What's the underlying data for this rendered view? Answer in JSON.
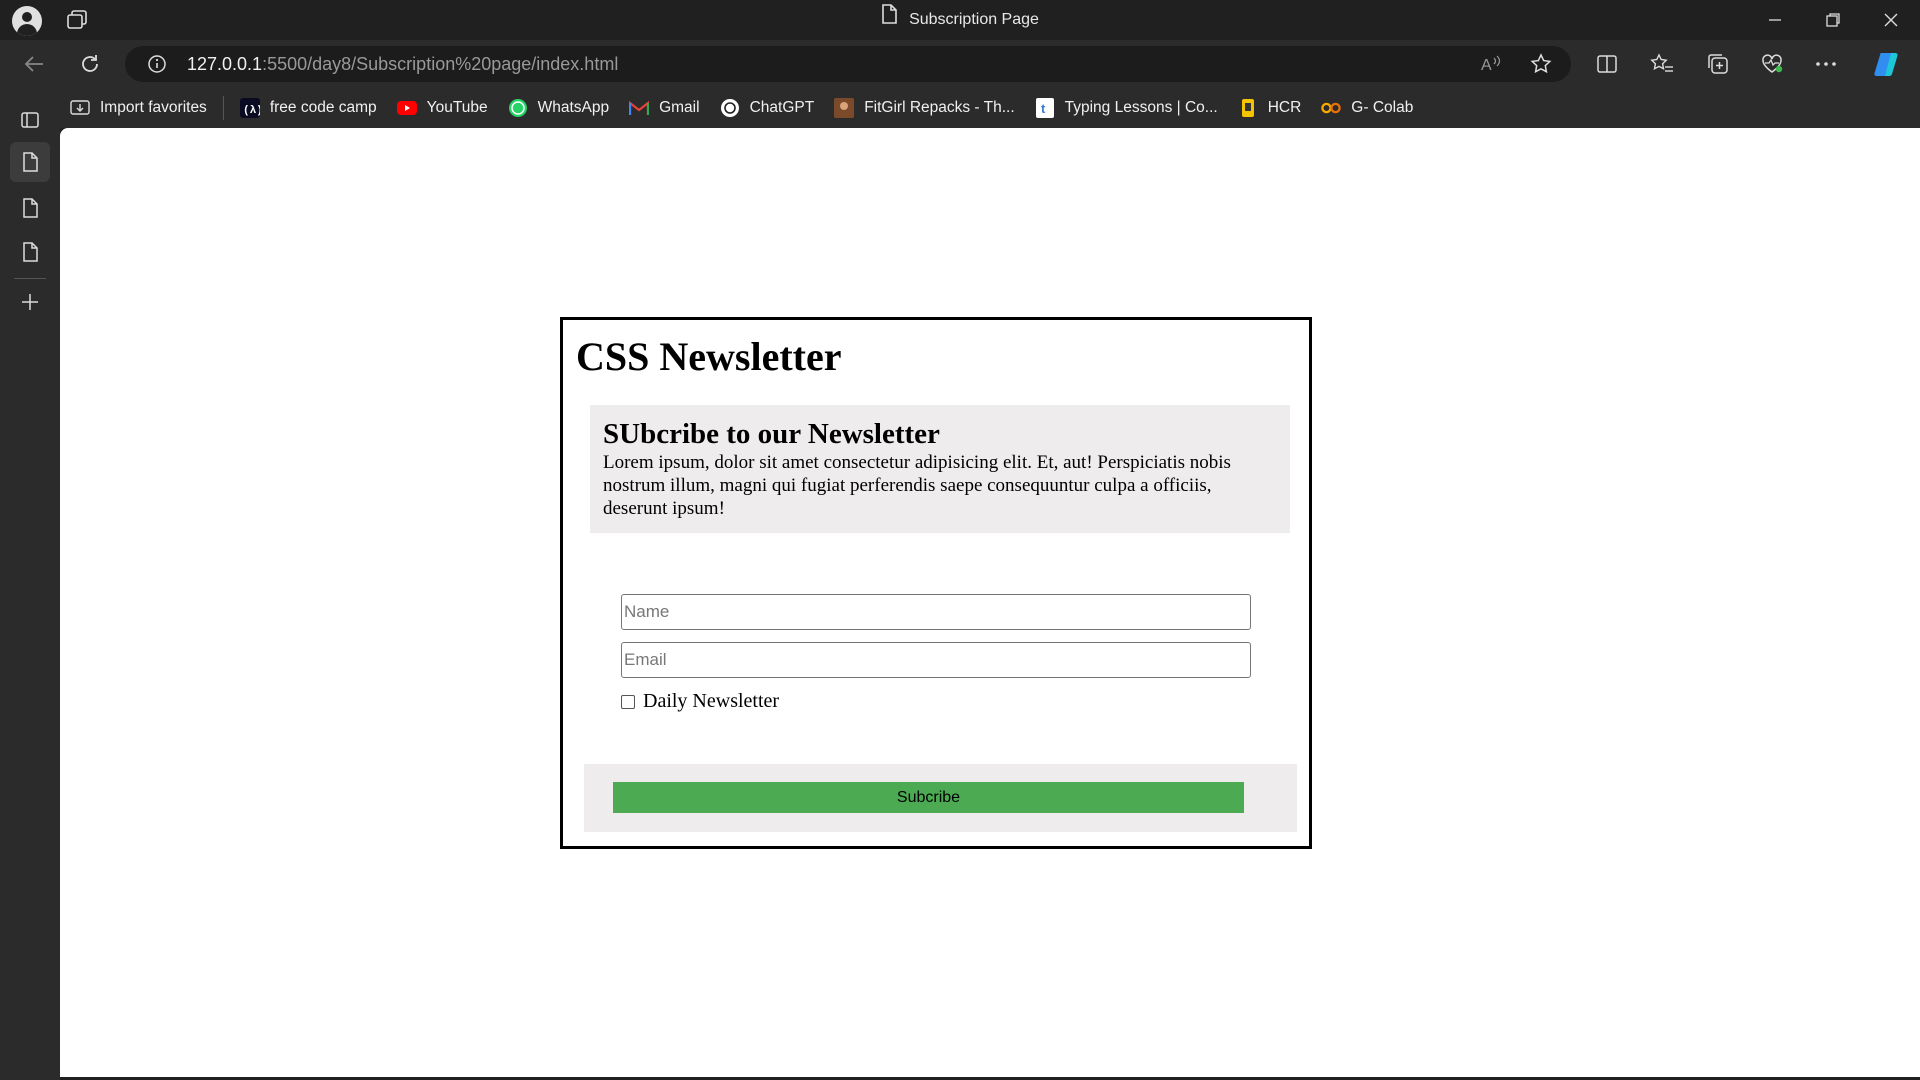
{
  "window": {
    "title": "Subscription Page",
    "url_host": "127.0.0.1",
    "url_path": ":5500/day8/Subscription%20page/index.html"
  },
  "bookmarks": [
    {
      "label": "Import favorites",
      "icon": "import-icon"
    },
    {
      "label": "free code camp",
      "icon": "freecodecamp-icon"
    },
    {
      "label": "YouTube",
      "icon": "youtube-icon"
    },
    {
      "label": "WhatsApp",
      "icon": "whatsapp-icon"
    },
    {
      "label": "Gmail",
      "icon": "gmail-icon"
    },
    {
      "label": "ChatGPT",
      "icon": "chatgpt-icon"
    },
    {
      "label": "FitGirl Repacks - Th...",
      "icon": "fitgirl-icon"
    },
    {
      "label": "Typing Lessons | Co...",
      "icon": "typing-icon"
    },
    {
      "label": "HCR",
      "icon": "hcr-icon"
    },
    {
      "label": "G- Colab",
      "icon": "colab-icon"
    }
  ],
  "page": {
    "heading": "CSS Newsletter",
    "panel_title": "SUbcribe to our Newsletter",
    "panel_text": "Lorem ipsum, dolor sit amet consectetur adipisicing elit. Et, aut! Perspiciatis nobis nostrum illum, magni qui fugiat perferendis saepe consequuntur culpa a officiis, deserunt ipsum!",
    "name_placeholder": "Name",
    "email_placeholder": "Email",
    "checkbox_label": "Daily Newsletter",
    "checkbox_checked": false,
    "button_label": "Subcribe"
  },
  "colors": {
    "button": "#4cab52",
    "panel": "#eeecec"
  }
}
